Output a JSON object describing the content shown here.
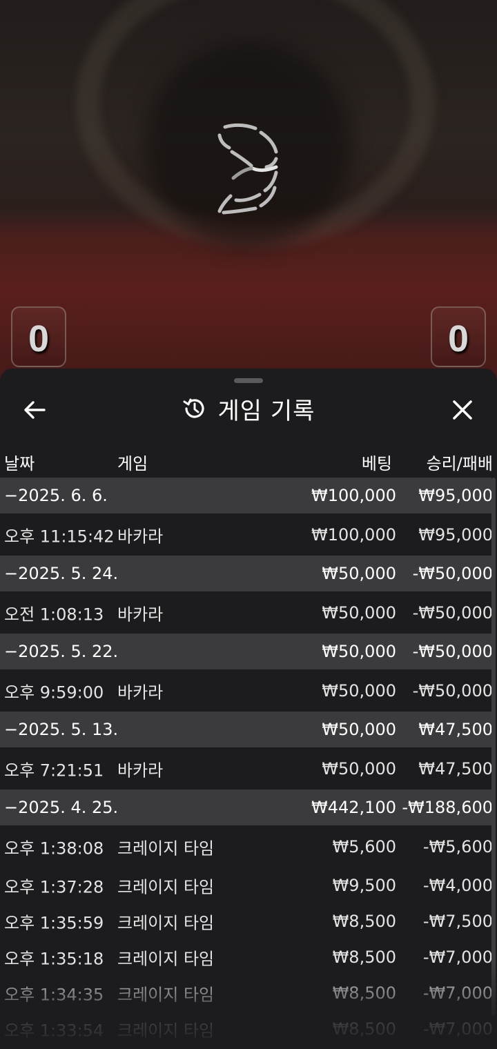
{
  "game_view": {
    "player_score": "0",
    "banker_score": "0"
  },
  "history": {
    "title": "게임 기록",
    "icons": {
      "back": "arrow-left-icon",
      "history": "history-clock-icon",
      "close": "close-x-icon",
      "loader": "loading-spinner-icon"
    },
    "columns": {
      "date": "날짜",
      "game": "게임",
      "bet": "베팅",
      "result": "승리/패배"
    },
    "rows": [
      {
        "type": "date",
        "date": "−2025. 6. 6.",
        "game": "",
        "bet": "₩100,000",
        "result": "₩95,000"
      },
      {
        "type": "item",
        "date": "오후 11:15:42",
        "game": "바카라",
        "bet": "₩100,000",
        "result": "₩95,000"
      },
      {
        "type": "date",
        "date": "−2025. 5. 24.",
        "game": "",
        "bet": "₩50,000",
        "result": "-₩50,000"
      },
      {
        "type": "item",
        "date": "오전 1:08:13",
        "game": "바카라",
        "bet": "₩50,000",
        "result": "-₩50,000"
      },
      {
        "type": "date",
        "date": "−2025. 5. 22.",
        "game": "",
        "bet": "₩50,000",
        "result": "-₩50,000"
      },
      {
        "type": "item",
        "date": "오후 9:59:00",
        "game": "바카라",
        "bet": "₩50,000",
        "result": "-₩50,000"
      },
      {
        "type": "date",
        "date": "−2025. 5. 13.",
        "game": "",
        "bet": "₩50,000",
        "result": "₩47,500"
      },
      {
        "type": "item",
        "date": "오후 7:21:51",
        "game": "바카라",
        "bet": "₩50,000",
        "result": "₩47,500"
      },
      {
        "type": "date",
        "date": "−2025. 4. 25.",
        "game": "",
        "bet": "₩442,100",
        "result": "-₩188,600"
      },
      {
        "type": "item",
        "date": "오후 1:38:08",
        "game": "크레이지 타임",
        "bet": "₩5,600",
        "result": "-₩5,600"
      },
      {
        "type": "item compact",
        "date": "오후 1:37:28",
        "game": "크레이지 타임",
        "bet": "₩9,500",
        "result": "-₩4,000"
      },
      {
        "type": "item compact",
        "date": "오후 1:35:59",
        "game": "크레이지 타임",
        "bet": "₩8,500",
        "result": "-₩7,500"
      },
      {
        "type": "item compact",
        "date": "오후 1:35:18",
        "game": "크레이지 타임",
        "bet": "₩8,500",
        "result": "-₩7,000"
      },
      {
        "type": "item compact",
        "date": "오후 1:34:35",
        "game": "크레이지 타임",
        "bet": "₩8,500",
        "result": "-₩7,000"
      },
      {
        "type": "item compact",
        "date": "오후 1:33:54",
        "game": "크레이지 타임",
        "bet": "₩8,500",
        "result": "-₩7,000"
      }
    ]
  }
}
